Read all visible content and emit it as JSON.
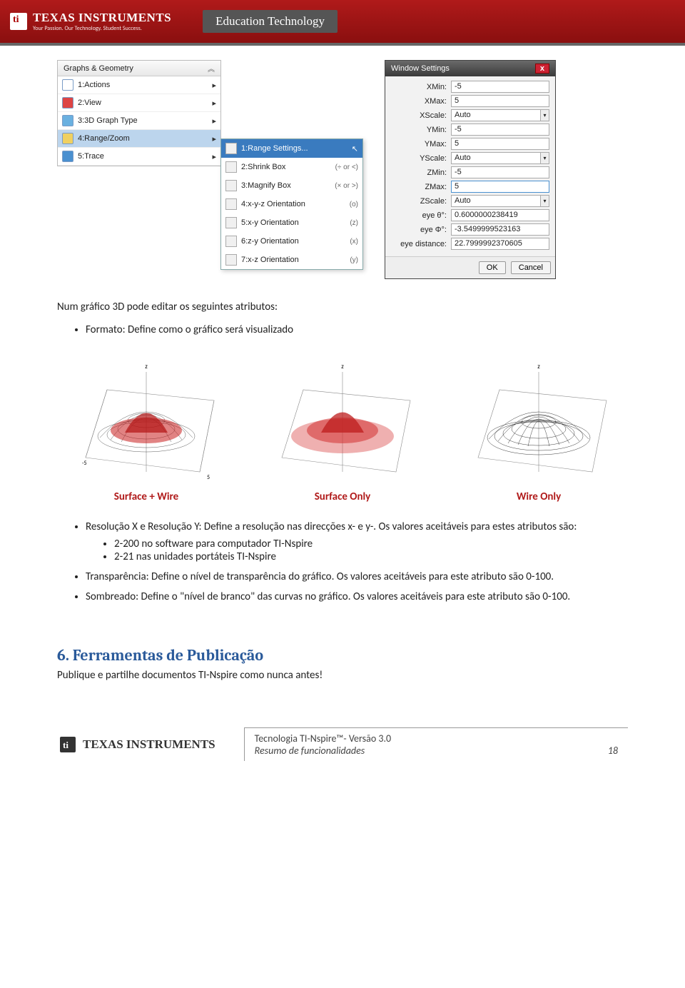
{
  "banner": {
    "brand": "TEXAS INSTRUMENTS",
    "tagline": "Your Passion. Our Technology. Student Success.",
    "section": "Education Technology"
  },
  "menu": {
    "title": "Graphs & Geometry",
    "items": [
      {
        "label": "1:Actions"
      },
      {
        "label": "2:View"
      },
      {
        "label": "3:3D Graph Type"
      },
      {
        "label": "4:Range/Zoom",
        "highlighted": true
      },
      {
        "label": "5:Trace"
      }
    ]
  },
  "submenu": [
    {
      "label": "1:Range Settings...",
      "highlighted": true
    },
    {
      "label": "2:Shrink Box",
      "short": "(÷ or <)"
    },
    {
      "label": "3:Magnify Box",
      "short": "(× or >)"
    },
    {
      "label": "4:x-y-z Orientation",
      "short": "(o)"
    },
    {
      "label": "5:x-y Orientation",
      "short": "(z)"
    },
    {
      "label": "6:z-y Orientation",
      "short": "(x)"
    },
    {
      "label": "7:x-z Orientation",
      "short": "(y)"
    }
  ],
  "settings": {
    "title": "Window Settings",
    "rows": [
      {
        "label": "XMin:",
        "value": "-5"
      },
      {
        "label": "XMax:",
        "value": "5"
      },
      {
        "label": "XScale:",
        "value": "Auto",
        "dropdown": true
      },
      {
        "label": "YMin:",
        "value": "-5"
      },
      {
        "label": "YMax:",
        "value": "5"
      },
      {
        "label": "YScale:",
        "value": "Auto",
        "dropdown": true
      },
      {
        "label": "ZMin:",
        "value": "-5"
      },
      {
        "label": "ZMax:",
        "value": "5",
        "focus": true
      },
      {
        "label": "ZScale:",
        "value": "Auto",
        "dropdown": true
      },
      {
        "label": "eye θ°:",
        "value": "0.6000000238419"
      },
      {
        "label": "eye Φ°:",
        "value": "-3.5499999523163"
      },
      {
        "label": "eye distance:",
        "value": "22.7999992370605"
      }
    ],
    "ok": "OK",
    "cancel": "Cancel"
  },
  "body": {
    "intro": "Num gráfico 3D pode editar os seguintes atributos:",
    "bullet_formato": "Formato: Define como o gráfico será visualizado",
    "caption1": "Surface + Wire",
    "caption2": "Surface Only",
    "caption3": "Wire Only",
    "bullet_resolucao": "Resolução X e Resolução Y: Define a resolução nas direcções x- e y-. Os valores aceitáveis para estes atributos são:",
    "sub1": "2-200 no software para computador TI-Nspire",
    "sub2": "2-21 nas unidades portáteis TI-Nspire",
    "bullet_transp": "Transparência: Define o nível de transparência do gráfico. Os valores aceitáveis para este atributo são 0-100.",
    "bullet_sombr": "Sombreado: Define o \"nível de branco\" das curvas no gráfico. Os valores aceitáveis para este atributo são 0-100."
  },
  "section6": {
    "title": "6. Ferramentas de Publicação",
    "text": "Publique e partilhe documentos TI-Nspire como nunca antes!"
  },
  "footer": {
    "brand": "TEXAS INSTRUMENTS",
    "line1": "Tecnologia TI-Nspire™- Versão 3.0",
    "line2": "Resumo de funcionalidades",
    "page": "18"
  }
}
